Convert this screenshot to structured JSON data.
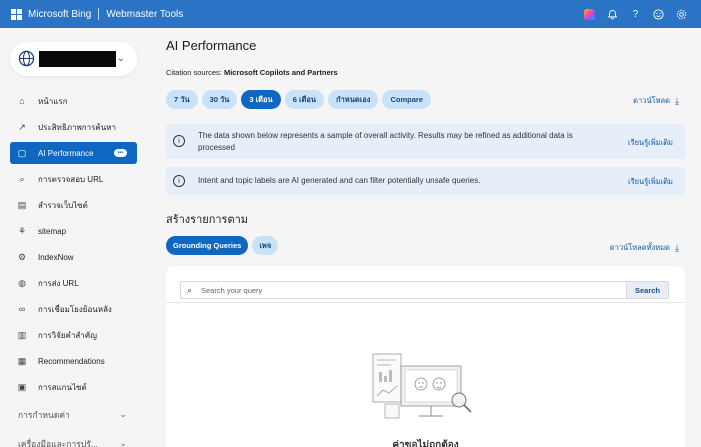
{
  "topbar": {
    "brand": "Microsoft Bing",
    "product": "Webmaster Tools",
    "icons": [
      "copilot-icon",
      "bell-icon",
      "help-icon",
      "feedback-smiley-icon",
      "settings-gear-icon"
    ]
  },
  "sidebar": {
    "items": [
      {
        "label": "หน้าแรก",
        "icon": "home-icon"
      },
      {
        "label": "ประสิทธิภาพการค้นหา",
        "icon": "trend-icon"
      },
      {
        "label": "AI Performance",
        "icon": "ai-icon",
        "active": true
      },
      {
        "label": "การตรวจสอบ URL",
        "icon": "search-icon"
      },
      {
        "label": "สำรวจเว็บไซต์",
        "icon": "document-icon"
      },
      {
        "label": "sitemap",
        "icon": "sitemap-icon"
      },
      {
        "label": "IndexNow",
        "icon": "indexnow-icon"
      },
      {
        "label": "การส่ง URL",
        "icon": "globe-icon"
      },
      {
        "label": "การเชื่อมโยงย้อนหลัง",
        "icon": "link-icon"
      },
      {
        "label": "การวิจัยคำสำคัญ",
        "icon": "keyword-icon"
      },
      {
        "label": "Recommendations",
        "icon": "recommendations-icon"
      },
      {
        "label": "การสแกนไซต์",
        "icon": "scan-icon"
      }
    ],
    "groups": [
      {
        "label": "การกำหนดค่า"
      },
      {
        "label": "เครื่องมือและการปรั..."
      }
    ]
  },
  "main": {
    "title": "AI Performance",
    "citation_label": "Citation sources:",
    "citation_value": "Microsoft Copilots and Partners",
    "periods": [
      "7 วัน",
      "30 วัน",
      "3 เดือน",
      "6 เดือน",
      "กำหนดเอง",
      "Compare"
    ],
    "active_period": "3 เดือน",
    "download": "ดาวน์โหลด",
    "info1": {
      "line1": "The data shown below represents a sample of overall activity. Results may be refined as additional data is",
      "line2": "processed",
      "link": "เรียนรู้เพิ่มเติม"
    },
    "info2": {
      "text": "Intent and topic labels are AI generated and can filter potentially unsafe queries.",
      "link": "เรียนรู้เพิ่มเติม"
    },
    "section_title": "สร้างรายการตาม",
    "tabs": [
      "Grounding Queries",
      "เพจ"
    ],
    "download_all": "ดาวน์โหลดทั้งหมด",
    "search": {
      "placeholder": "Search your query",
      "button": "Search"
    },
    "empty_title": "ค่าขอไม่ถูกต้อง"
  }
}
